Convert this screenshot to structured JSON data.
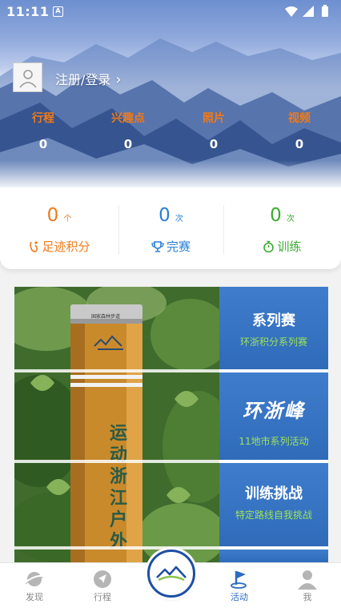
{
  "status_bar": {
    "time": "11:11",
    "notification_icon": "A"
  },
  "profile": {
    "login_label": "注册/登录"
  },
  "stats": [
    {
      "label": "行程",
      "value": "0"
    },
    {
      "label": "兴趣点",
      "value": "0"
    },
    {
      "label": "照片",
      "value": "0"
    },
    {
      "label": "视频",
      "value": "0"
    }
  ],
  "summary": [
    {
      "value": "0",
      "unit": "个",
      "label": "足迹积分",
      "color": "#f07a18",
      "icon": "footprint-icon"
    },
    {
      "value": "0",
      "unit": "次",
      "label": "完赛",
      "color": "#2a7fd6",
      "icon": "trophy-icon"
    },
    {
      "value": "0",
      "unit": "次",
      "label": "训练",
      "color": "#3aac2f",
      "icon": "stopwatch-icon"
    }
  ],
  "photo_text": {
    "post_text": "运动浙江 户外",
    "plate_text": "国家森林步道"
  },
  "tiles": [
    {
      "title": "系列赛",
      "subtitle": "环浙积分系列赛"
    },
    {
      "title": "环浙峰",
      "subtitle": "11地市系列活动"
    },
    {
      "title": "训练挑战",
      "subtitle": "特定路线自我挑战"
    }
  ],
  "nav": {
    "items": [
      {
        "label": "发现",
        "icon": "planet-icon"
      },
      {
        "label": "行程",
        "icon": "navigation-arrow-icon"
      },
      {
        "label": "活动",
        "icon": "flag-icon"
      },
      {
        "label": "我",
        "icon": "user-icon"
      }
    ],
    "center_icon": "mountain-logo-icon",
    "active": "活动"
  },
  "colors": {
    "accent_orange": "#f07a18",
    "accent_blue": "#2a6cc4",
    "accent_green": "#3aac2f",
    "tile_blue": "#3f7dcc"
  }
}
